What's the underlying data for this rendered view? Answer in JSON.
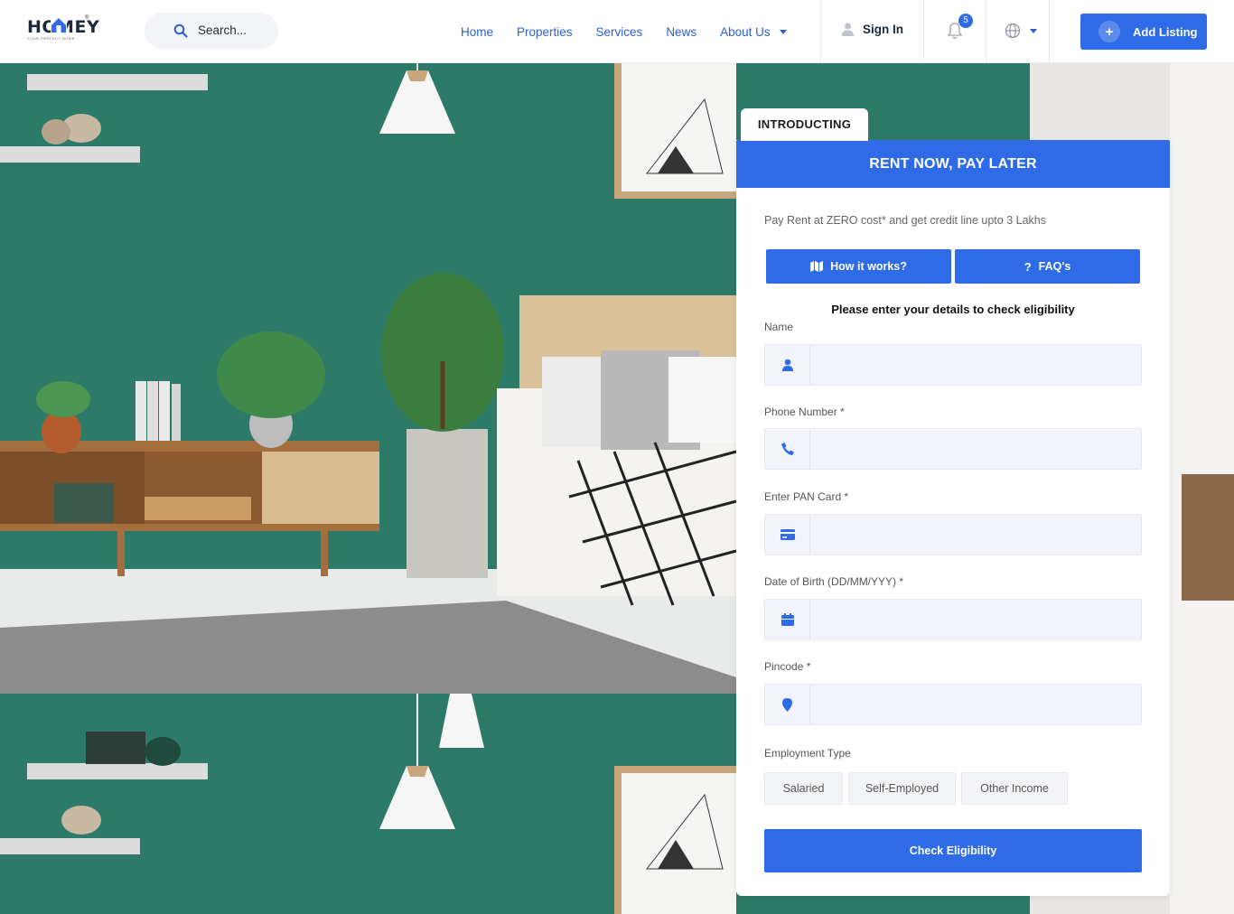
{
  "header": {
    "logo_text": "HOMEY",
    "logo_tagline": "YOUR PERFECT HOME",
    "search_placeholder": "Search...",
    "nav": [
      {
        "label": "Home"
      },
      {
        "label": "Properties"
      },
      {
        "label": "Services"
      },
      {
        "label": "News"
      },
      {
        "label": "About Us"
      }
    ],
    "signin_label": "Sign In",
    "notification_count": "5",
    "add_listing_label": "Add Listing"
  },
  "form": {
    "intro_tab": "INTRODUCTING",
    "title": "RENT NOW, PAY LATER",
    "subtitle": "Pay Rent at ZERO cost* and get credit line upto 3 Lakhs",
    "how_label": "How it works?",
    "faq_label": "FAQ's",
    "prompt": "Please enter your details to check eligibility",
    "fields": [
      {
        "label": "Name",
        "icon": "user-icon"
      },
      {
        "label": "Phone Number *",
        "icon": "phone-icon"
      },
      {
        "label": "Enter PAN Card *",
        "icon": "card-icon"
      },
      {
        "label": "Date of Birth (DD/MM/YYY) *",
        "icon": "calendar-icon"
      },
      {
        "label": "Pincode *",
        "icon": "map-pin-icon"
      }
    ],
    "employment_label": "Employment Type",
    "employment_options": [
      "Salaried",
      "Self-Employed",
      "Other Income"
    ],
    "submit_label": "Check Eligibility"
  },
  "colors": {
    "accent": "#2f6be6",
    "nav_text": "#2f5fd0",
    "wall": "#2e7a68"
  }
}
